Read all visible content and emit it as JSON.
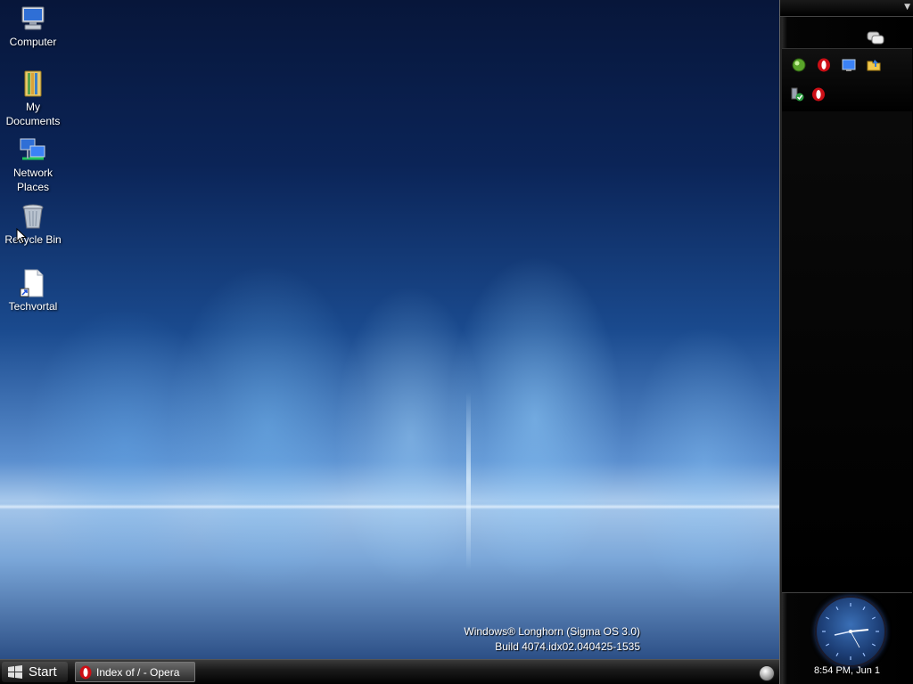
{
  "desktop": {
    "icons": [
      {
        "label_line1": "Computer",
        "label_line2": "",
        "icon": "computer-icon"
      },
      {
        "label_line1": "My",
        "label_line2": "Documents",
        "icon": "documents-folder-icon"
      },
      {
        "label_line1": "Network",
        "label_line2": "Places",
        "icon": "network-icon"
      },
      {
        "label_line1": "Recycle Bin",
        "label_line2": "",
        "icon": "recycle-bin-icon"
      },
      {
        "label_line1": "Techvortal",
        "label_line2": "",
        "icon": "shortcut-file-icon"
      }
    ],
    "watermark": {
      "line1": "Windows® Longhorn (Sigma OS 3.0)",
      "line2": "Build 4074.idx02.040425-1535"
    }
  },
  "taskbar": {
    "start_label": "Start",
    "tasks": [
      {
        "label": "Index of / - Opera",
        "icon": "opera-icon"
      }
    ]
  },
  "sidebar": {
    "top_icons": [
      "chat-bubble-icon"
    ],
    "tile_row1": [
      "green-orb-icon",
      "opera-icon",
      "monitor-icon",
      "folder-icon"
    ],
    "tile_row2": [
      "security-check-icon",
      "opera-icon"
    ],
    "clock": {
      "time_text": "8:54 PM, Jun 1"
    }
  },
  "colors": {
    "wallpaper_top": "#07163a",
    "wallpaper_glow": "#a8c9ec",
    "taskbar": "#1a1a1a",
    "sidebar": "#000000",
    "opera_red": "#cc0f16"
  }
}
